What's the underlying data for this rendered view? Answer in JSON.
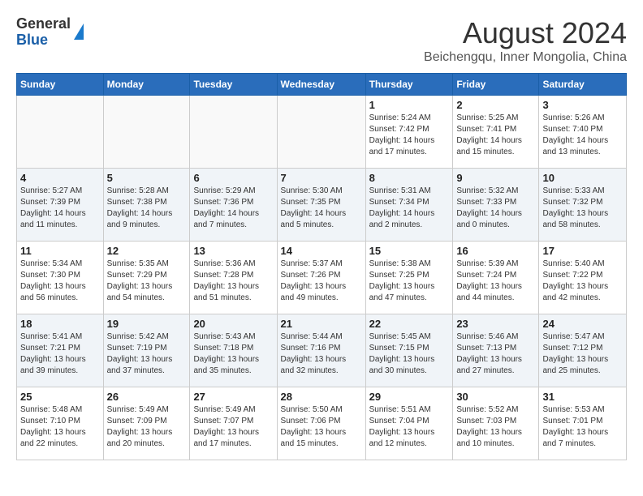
{
  "header": {
    "logo": {
      "line1": "General",
      "line2": "Blue"
    },
    "title": "August 2024",
    "subtitle": "Beichengqu, Inner Mongolia, China"
  },
  "weekdays": [
    "Sunday",
    "Monday",
    "Tuesday",
    "Wednesday",
    "Thursday",
    "Friday",
    "Saturday"
  ],
  "weeks": [
    [
      {
        "day": "",
        "info": ""
      },
      {
        "day": "",
        "info": ""
      },
      {
        "day": "",
        "info": ""
      },
      {
        "day": "",
        "info": ""
      },
      {
        "day": "1",
        "info": "Sunrise: 5:24 AM\nSunset: 7:42 PM\nDaylight: 14 hours\nand 17 minutes."
      },
      {
        "day": "2",
        "info": "Sunrise: 5:25 AM\nSunset: 7:41 PM\nDaylight: 14 hours\nand 15 minutes."
      },
      {
        "day": "3",
        "info": "Sunrise: 5:26 AM\nSunset: 7:40 PM\nDaylight: 14 hours\nand 13 minutes."
      }
    ],
    [
      {
        "day": "4",
        "info": "Sunrise: 5:27 AM\nSunset: 7:39 PM\nDaylight: 14 hours\nand 11 minutes."
      },
      {
        "day": "5",
        "info": "Sunrise: 5:28 AM\nSunset: 7:38 PM\nDaylight: 14 hours\nand 9 minutes."
      },
      {
        "day": "6",
        "info": "Sunrise: 5:29 AM\nSunset: 7:36 PM\nDaylight: 14 hours\nand 7 minutes."
      },
      {
        "day": "7",
        "info": "Sunrise: 5:30 AM\nSunset: 7:35 PM\nDaylight: 14 hours\nand 5 minutes."
      },
      {
        "day": "8",
        "info": "Sunrise: 5:31 AM\nSunset: 7:34 PM\nDaylight: 14 hours\nand 2 minutes."
      },
      {
        "day": "9",
        "info": "Sunrise: 5:32 AM\nSunset: 7:33 PM\nDaylight: 14 hours\nand 0 minutes."
      },
      {
        "day": "10",
        "info": "Sunrise: 5:33 AM\nSunset: 7:32 PM\nDaylight: 13 hours\nand 58 minutes."
      }
    ],
    [
      {
        "day": "11",
        "info": "Sunrise: 5:34 AM\nSunset: 7:30 PM\nDaylight: 13 hours\nand 56 minutes."
      },
      {
        "day": "12",
        "info": "Sunrise: 5:35 AM\nSunset: 7:29 PM\nDaylight: 13 hours\nand 54 minutes."
      },
      {
        "day": "13",
        "info": "Sunrise: 5:36 AM\nSunset: 7:28 PM\nDaylight: 13 hours\nand 51 minutes."
      },
      {
        "day": "14",
        "info": "Sunrise: 5:37 AM\nSunset: 7:26 PM\nDaylight: 13 hours\nand 49 minutes."
      },
      {
        "day": "15",
        "info": "Sunrise: 5:38 AM\nSunset: 7:25 PM\nDaylight: 13 hours\nand 47 minutes."
      },
      {
        "day": "16",
        "info": "Sunrise: 5:39 AM\nSunset: 7:24 PM\nDaylight: 13 hours\nand 44 minutes."
      },
      {
        "day": "17",
        "info": "Sunrise: 5:40 AM\nSunset: 7:22 PM\nDaylight: 13 hours\nand 42 minutes."
      }
    ],
    [
      {
        "day": "18",
        "info": "Sunrise: 5:41 AM\nSunset: 7:21 PM\nDaylight: 13 hours\nand 39 minutes."
      },
      {
        "day": "19",
        "info": "Sunrise: 5:42 AM\nSunset: 7:19 PM\nDaylight: 13 hours\nand 37 minutes."
      },
      {
        "day": "20",
        "info": "Sunrise: 5:43 AM\nSunset: 7:18 PM\nDaylight: 13 hours\nand 35 minutes."
      },
      {
        "day": "21",
        "info": "Sunrise: 5:44 AM\nSunset: 7:16 PM\nDaylight: 13 hours\nand 32 minutes."
      },
      {
        "day": "22",
        "info": "Sunrise: 5:45 AM\nSunset: 7:15 PM\nDaylight: 13 hours\nand 30 minutes."
      },
      {
        "day": "23",
        "info": "Sunrise: 5:46 AM\nSunset: 7:13 PM\nDaylight: 13 hours\nand 27 minutes."
      },
      {
        "day": "24",
        "info": "Sunrise: 5:47 AM\nSunset: 7:12 PM\nDaylight: 13 hours\nand 25 minutes."
      }
    ],
    [
      {
        "day": "25",
        "info": "Sunrise: 5:48 AM\nSunset: 7:10 PM\nDaylight: 13 hours\nand 22 minutes."
      },
      {
        "day": "26",
        "info": "Sunrise: 5:49 AM\nSunset: 7:09 PM\nDaylight: 13 hours\nand 20 minutes."
      },
      {
        "day": "27",
        "info": "Sunrise: 5:49 AM\nSunset: 7:07 PM\nDaylight: 13 hours\nand 17 minutes."
      },
      {
        "day": "28",
        "info": "Sunrise: 5:50 AM\nSunset: 7:06 PM\nDaylight: 13 hours\nand 15 minutes."
      },
      {
        "day": "29",
        "info": "Sunrise: 5:51 AM\nSunset: 7:04 PM\nDaylight: 13 hours\nand 12 minutes."
      },
      {
        "day": "30",
        "info": "Sunrise: 5:52 AM\nSunset: 7:03 PM\nDaylight: 13 hours\nand 10 minutes."
      },
      {
        "day": "31",
        "info": "Sunrise: 5:53 AM\nSunset: 7:01 PM\nDaylight: 13 hours\nand 7 minutes."
      }
    ]
  ]
}
